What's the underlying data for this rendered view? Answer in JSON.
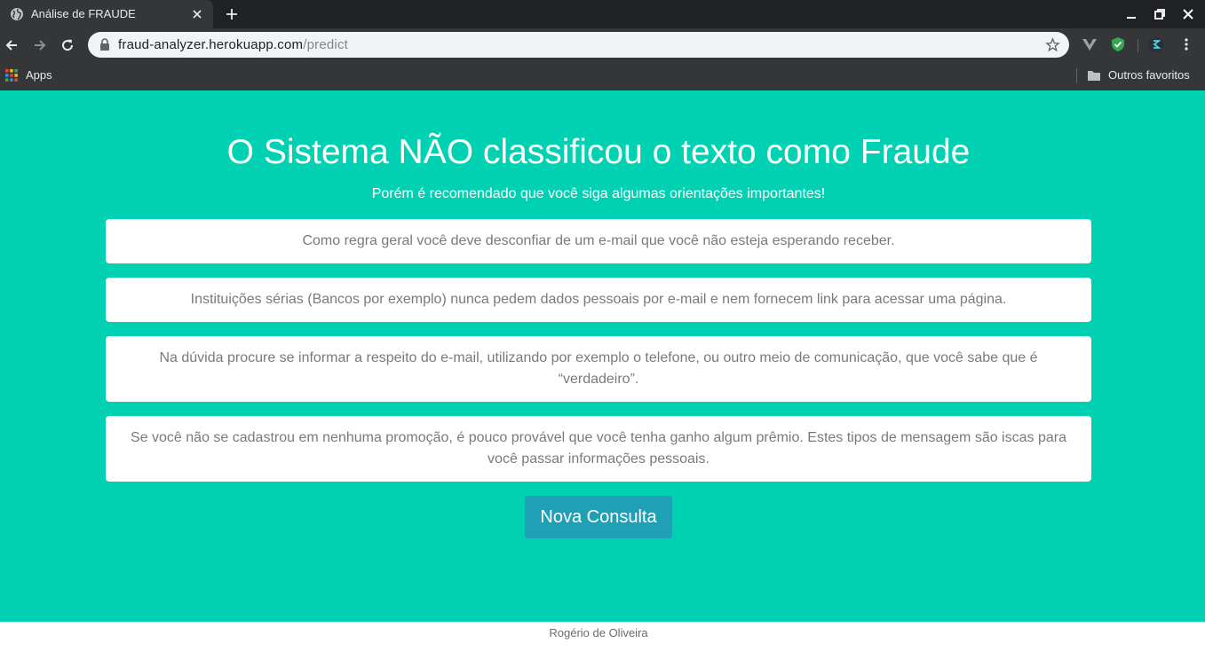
{
  "browser": {
    "tab_title": "Análise de FRAUDE",
    "url_host": "fraud-analyzer.herokuapp.com",
    "url_path": "/predict",
    "bookmarks": {
      "apps_label": "Apps",
      "other_label": "Outros favoritos"
    }
  },
  "page": {
    "title": "O Sistema NÃO classificou o texto como Fraude",
    "subtitle": "Porém é recomendado que você siga algumas orientações importantes!",
    "tips": [
      "Como regra geral você deve desconfiar de um e-mail que você não esteja esperando receber.",
      "Instituições sérias (Bancos por exemplo) nunca pedem dados pessoais por e-mail e nem fornecem link para acessar uma página.",
      "Na dúvida procure se informar a respeito do e-mail, utilizando por exemplo o telefone, ou outro meio de comunicação, que você sabe que é “verdadeiro”.",
      "Se você não se cadastrou em nenhuma promoção, é pouco provável que você tenha ganho algum prêmio. Estes tipos de mensagem são iscas para você passar informações pessoais."
    ],
    "button_label": "Nova Consulta",
    "footer": "Rogério de Oliveira"
  },
  "colors": {
    "hero_background": "#00d1b2",
    "button_background": "#1fa0b6",
    "tip_text": "#7a7a7a"
  },
  "icons": [
    "globe-icon",
    "close-icon",
    "plus-icon",
    "minimize-icon",
    "restore-icon",
    "back-icon",
    "forward-icon",
    "reload-icon",
    "lock-icon",
    "star-icon",
    "vue-devtools-icon",
    "shield-icon",
    "extension-icon",
    "more-vert-icon",
    "apps-grid-icon",
    "folder-icon"
  ]
}
